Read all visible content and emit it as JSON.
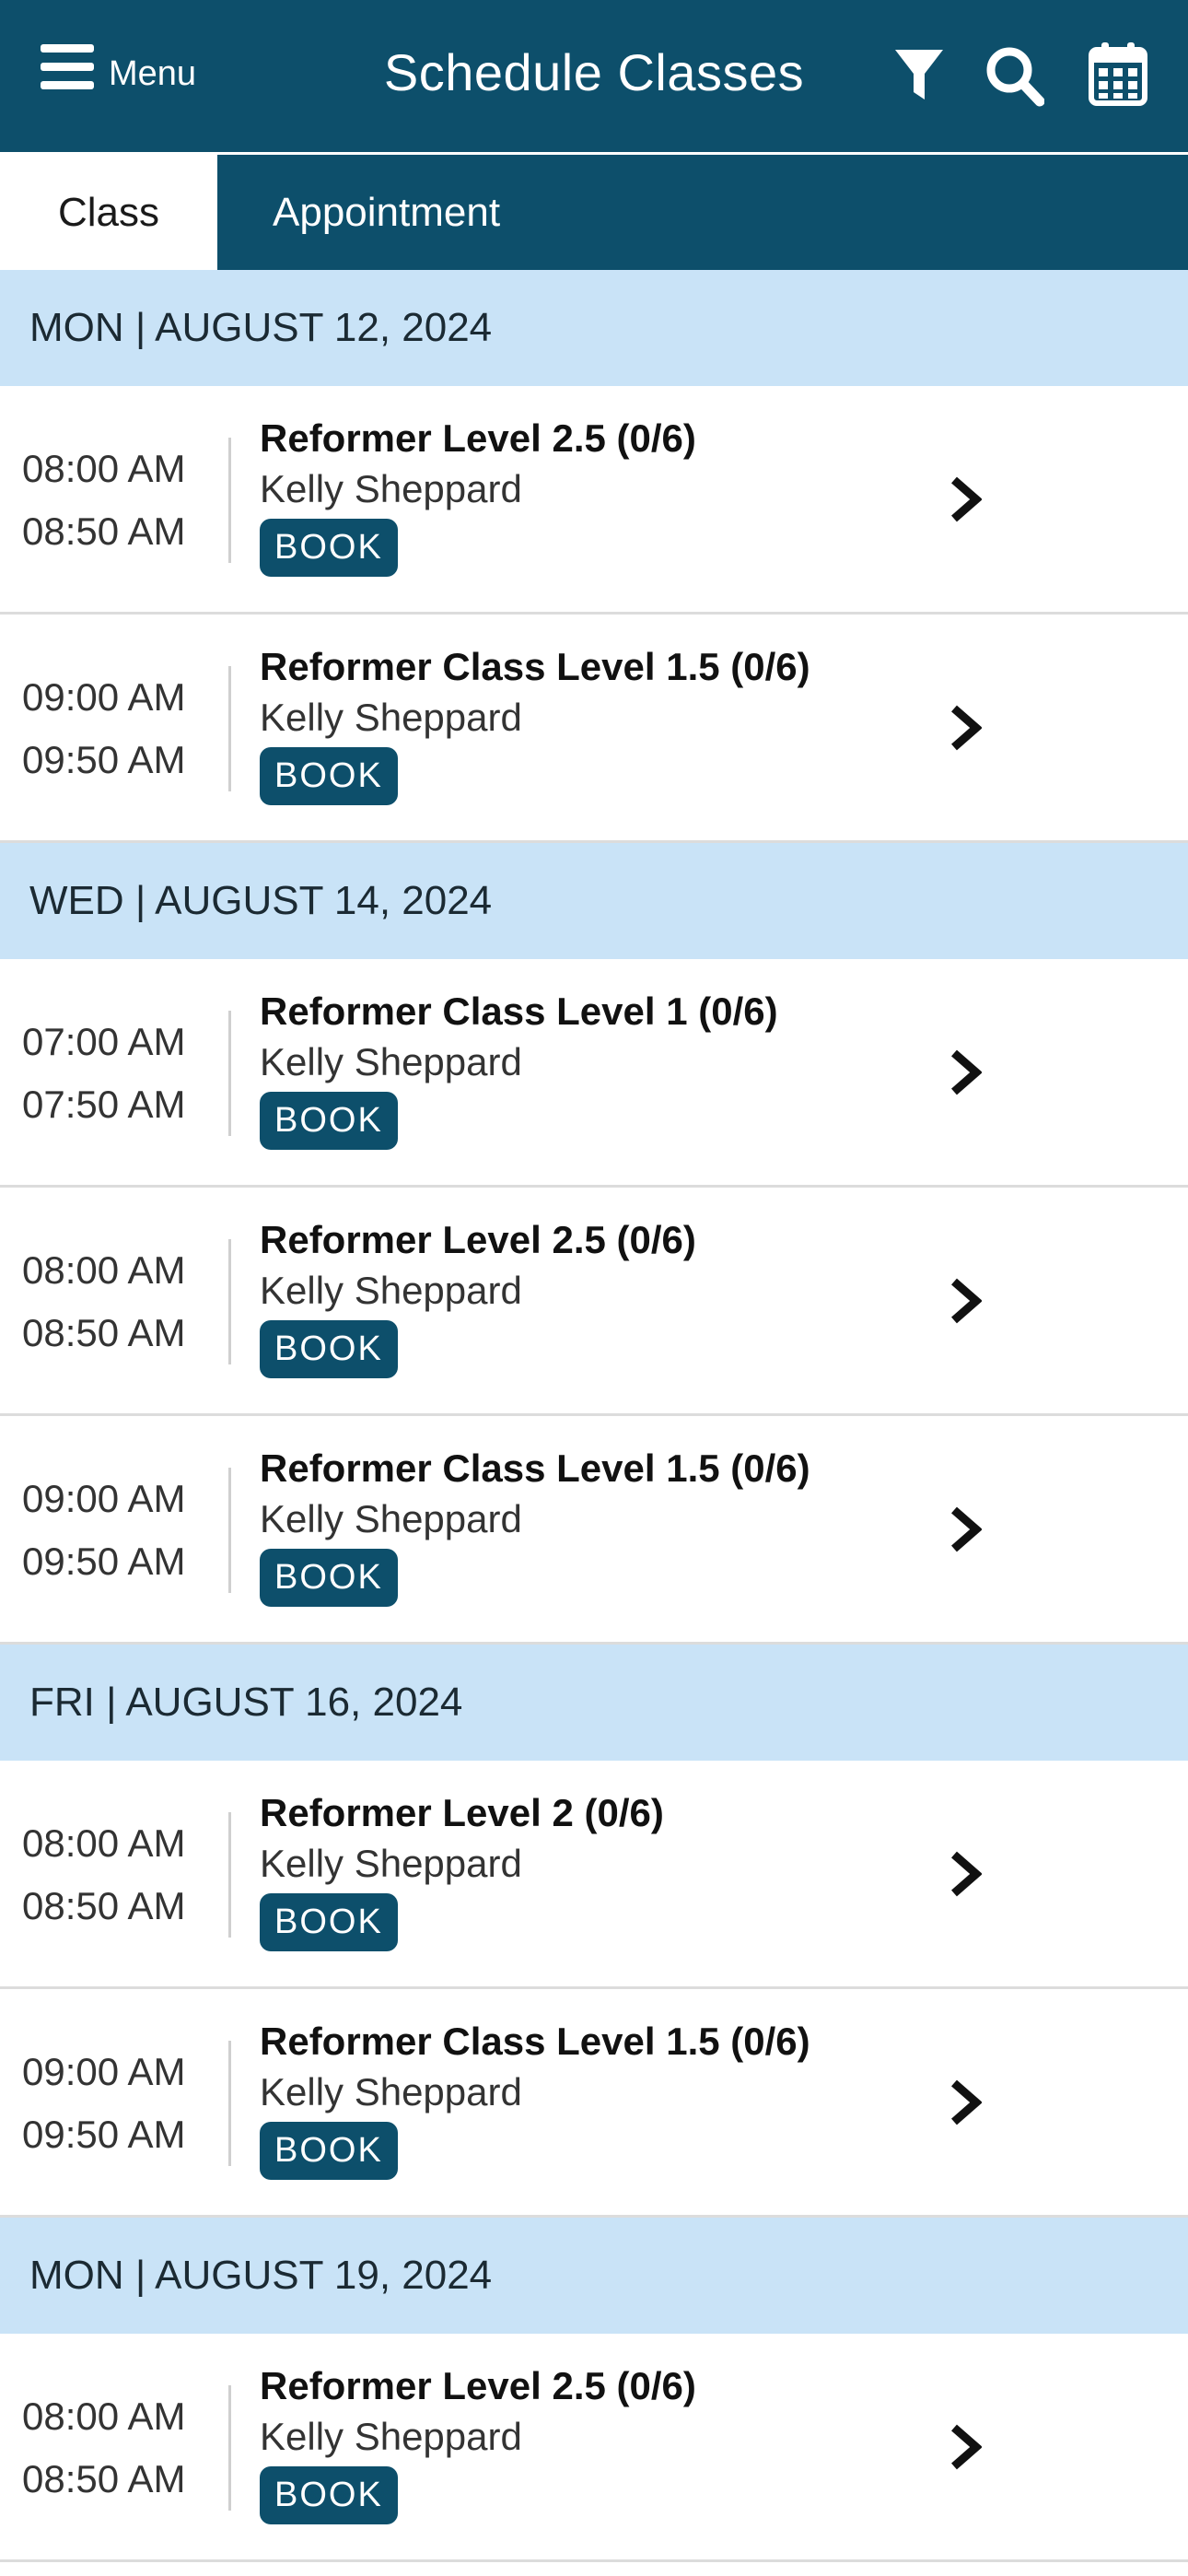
{
  "header": {
    "menu_label": "Menu",
    "title": "Schedule Classes",
    "icons": [
      "menu-icon",
      "filter-icon",
      "search-icon",
      "calendar-icon"
    ]
  },
  "tabs": [
    {
      "label": "Class",
      "active": true
    },
    {
      "label": "Appointment",
      "active": false
    }
  ],
  "colors": {
    "brand": "#0d4f6b",
    "day_header_bg": "#c9e3f7",
    "divider": "#dcdcdc"
  },
  "days": [
    {
      "date": "MON | AUGUST 12, 2024",
      "classes": [
        {
          "start": "08:00 AM",
          "end": "08:50 AM",
          "name": "Reformer Level 2.5 (0/6)",
          "instructor": "Kelly Sheppard",
          "button": "BOOK"
        },
        {
          "start": "09:00 AM",
          "end": "09:50 AM",
          "name": "Reformer Class Level 1.5 (0/6)",
          "instructor": "Kelly Sheppard",
          "button": "BOOK"
        }
      ]
    },
    {
      "date": "WED | AUGUST 14, 2024",
      "classes": [
        {
          "start": "07:00 AM",
          "end": "07:50 AM",
          "name": "Reformer Class Level 1 (0/6)",
          "instructor": "Kelly Sheppard",
          "button": "BOOK"
        },
        {
          "start": "08:00 AM",
          "end": "08:50 AM",
          "name": "Reformer Level 2.5 (0/6)",
          "instructor": "Kelly Sheppard",
          "button": "BOOK"
        },
        {
          "start": "09:00 AM",
          "end": "09:50 AM",
          "name": "Reformer Class Level 1.5 (0/6)",
          "instructor": "Kelly Sheppard",
          "button": "BOOK"
        }
      ]
    },
    {
      "date": "FRI | AUGUST 16, 2024",
      "classes": [
        {
          "start": "08:00 AM",
          "end": "08:50 AM",
          "name": "Reformer Level 2 (0/6)",
          "instructor": "Kelly Sheppard",
          "button": "BOOK"
        },
        {
          "start": "09:00 AM",
          "end": "09:50 AM",
          "name": "Reformer Class Level 1.5 (0/6)",
          "instructor": "Kelly Sheppard",
          "button": "BOOK"
        }
      ]
    },
    {
      "date": "MON | AUGUST 19, 2024",
      "classes": [
        {
          "start": "08:00 AM",
          "end": "08:50 AM",
          "name": "Reformer Level 2.5 (0/6)",
          "instructor": "Kelly Sheppard",
          "button": "BOOK"
        }
      ]
    }
  ]
}
